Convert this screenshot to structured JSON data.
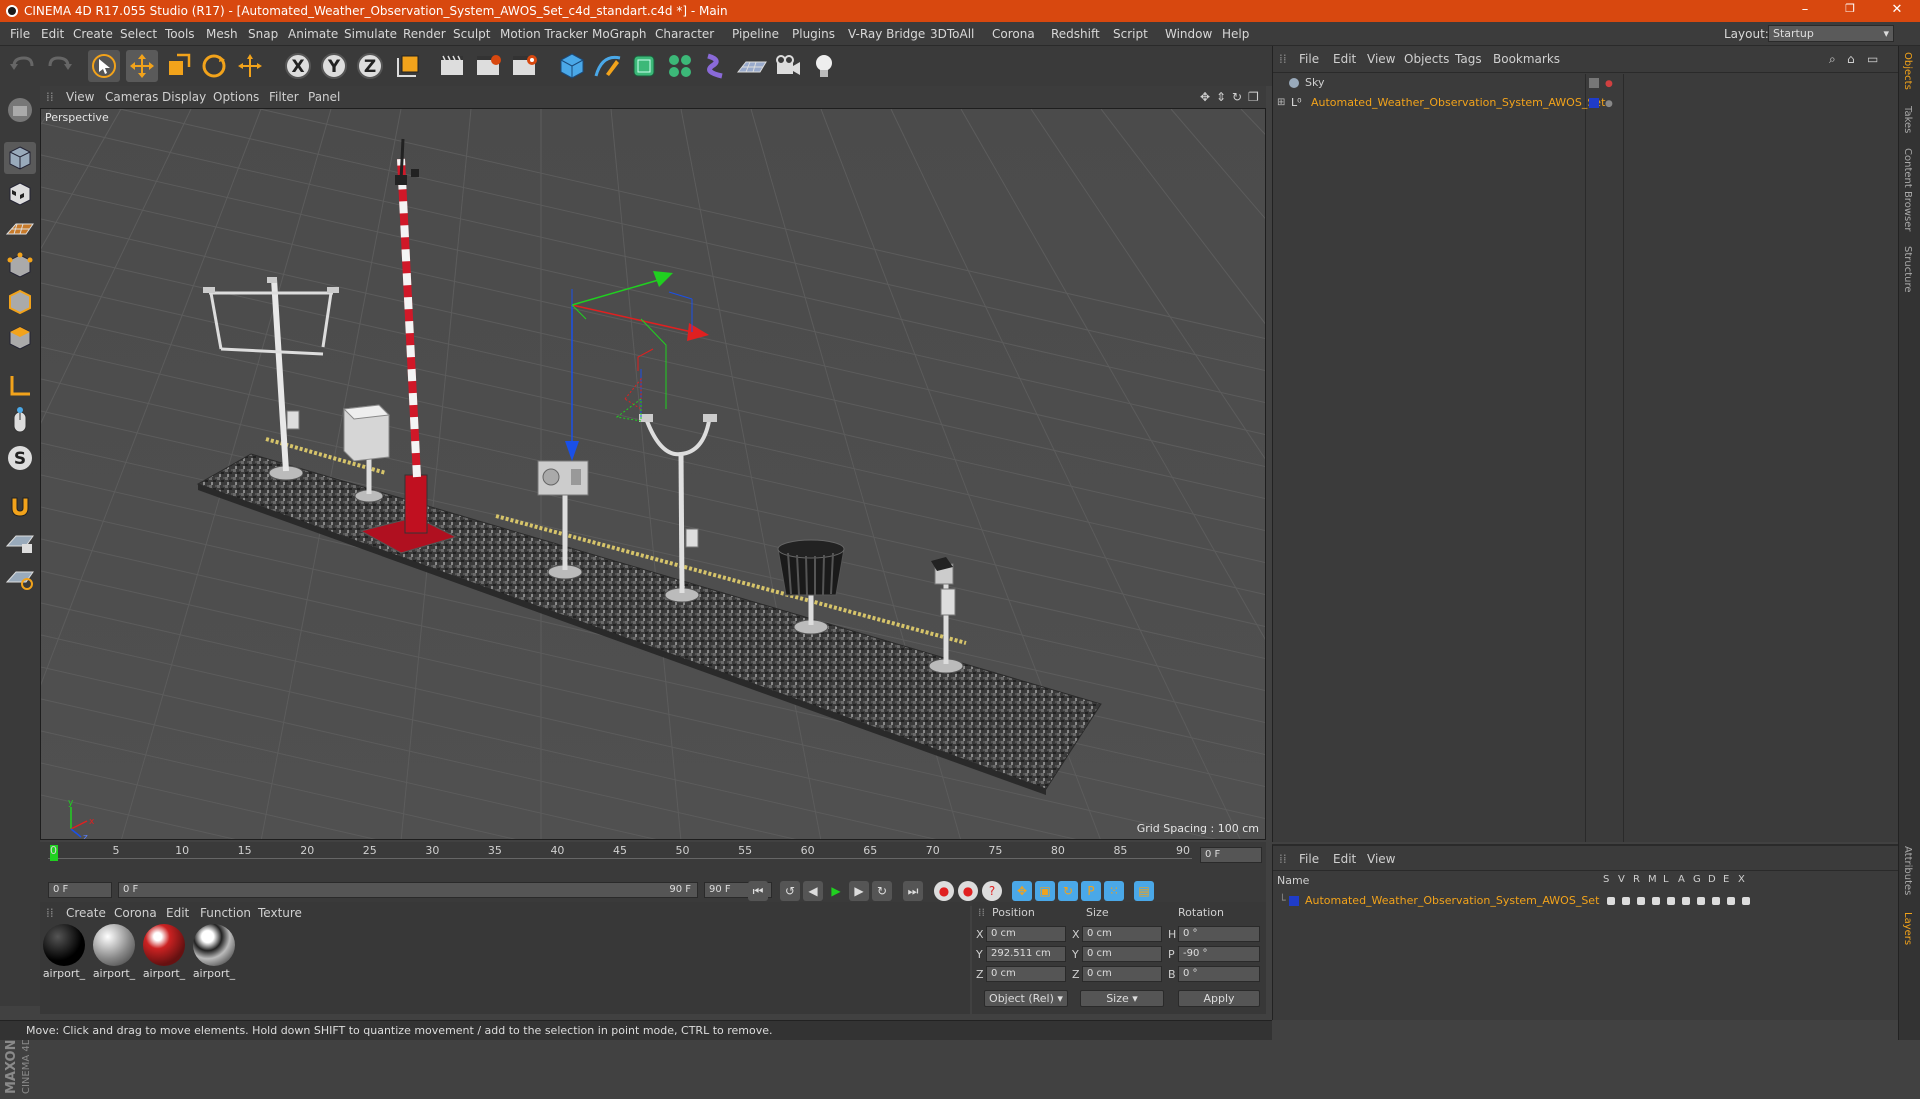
{
  "window": {
    "title": "CINEMA 4D R17.055 Studio (R17) - [Automated_Weather_Observation_System_AWOS_Set_c4d_standart.c4d *] - Main",
    "min": "–",
    "max": "❐",
    "close": "✕"
  },
  "menu": [
    "File",
    "Edit",
    "Create",
    "Select",
    "Tools",
    "Mesh",
    "Snap",
    "Animate",
    "Simulate",
    "Render",
    "Sculpt",
    "Motion Tracker",
    "MoGraph",
    "Character",
    "Pipeline",
    "Plugins",
    "V-Ray Bridge",
    "3DToAll",
    "Corona",
    "Redshift",
    "Script",
    "Window",
    "Help"
  ],
  "layout": {
    "label": "Layout:",
    "value": "Startup"
  },
  "viewport": {
    "menu": [
      "View",
      "Cameras",
      "Display",
      "Options",
      "Filter",
      "Panel"
    ],
    "label": "Perspective",
    "grid": "Grid Spacing : 100 cm"
  },
  "timeline": {
    "ticks": [
      "0",
      "5",
      "10",
      "15",
      "20",
      "25",
      "30",
      "35",
      "40",
      "45",
      "50",
      "55",
      "60",
      "65",
      "70",
      "75",
      "80",
      "85",
      "90"
    ],
    "end_field": "0 F",
    "start": "0 F",
    "slider_start": "0 F",
    "slider_end": "90 F",
    "end": "90 F"
  },
  "materials": {
    "menu": [
      "Create",
      "Corona",
      "Edit",
      "Function",
      "Texture"
    ],
    "items": [
      "airport_",
      "airport_",
      "airport_",
      "airport_"
    ]
  },
  "coords": {
    "headers": [
      "Position",
      "Size",
      "Rotation"
    ],
    "rows": [
      {
        "axis": "X",
        "pos": "0 cm",
        "saxis": "X",
        "size": "0 cm",
        "raxis": "H",
        "rot": "0 °"
      },
      {
        "axis": "Y",
        "pos": "292.511 cm",
        "saxis": "Y",
        "size": "0 cm",
        "raxis": "P",
        "rot": "-90 °"
      },
      {
        "axis": "Z",
        "pos": "0 cm",
        "saxis": "Z",
        "size": "0 cm",
        "raxis": "B",
        "rot": "0 °"
      }
    ],
    "mode": "Object (Rel)",
    "size_mode": "Size",
    "apply": "Apply"
  },
  "status": "Move: Click and drag to move elements. Hold down SHIFT to quantize movement / add to the selection in point mode, CTRL to remove.",
  "objmgr": {
    "menu": [
      "File",
      "Edit",
      "View",
      "Objects",
      "Tags",
      "Bookmarks"
    ],
    "objects": [
      "Sky",
      "Automated_Weather_Observation_System_AWOS_Set"
    ]
  },
  "layermgr": {
    "menu": [
      "File",
      "Edit",
      "View"
    ],
    "name_header": "Name",
    "cols": [
      "S",
      "V",
      "R",
      "M",
      "L",
      "A",
      "G",
      "D",
      "E",
      "X"
    ],
    "layer": "Automated_Weather_Observation_System_AWOS_Set"
  },
  "side_tabs": [
    "Objects",
    "Takes",
    "Content Browser",
    "Structure",
    "Attributes",
    "Layers"
  ],
  "maxon": "MAXON CINEMA 4D",
  "colors": {
    "title": "#d8480f",
    "accent": "#f2a31b",
    "layer": "#1f3cc9"
  }
}
